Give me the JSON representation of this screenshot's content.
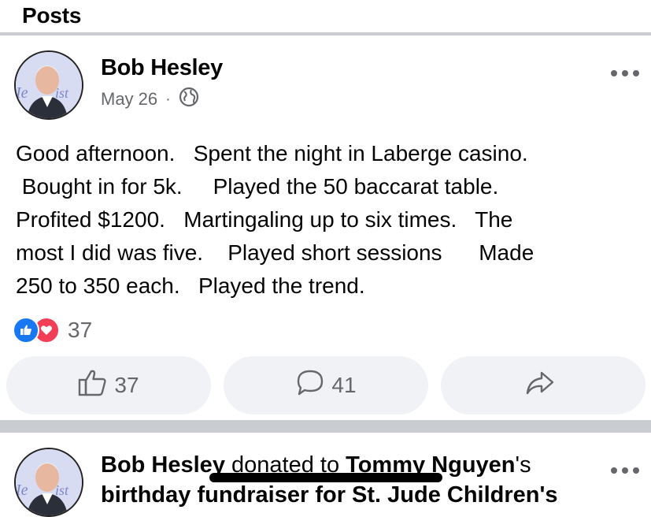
{
  "section": {
    "title": "Posts"
  },
  "post1": {
    "author": "Bob Hesley",
    "date": "May 26",
    "separator": "·",
    "visibility_icon": "globe-icon",
    "text": "Good afternoon.   Spent the night in Laberge casino.\n Bought in for 5k.     Played the 50 baccarat table.\nProfited $1200.   Martingaling up to six times.   The\nmost I did was five.    Played short sessions      Made\n250 to 350 each.   Played the trend.",
    "reactions": {
      "icons": [
        "like-icon",
        "love-icon"
      ],
      "count": "37"
    },
    "actions": {
      "like_count": "37",
      "comment_count": "41",
      "share_icon": "share-icon"
    }
  },
  "post2": {
    "author": "Bob Hesley",
    "verb": " donated to ",
    "target": "Tommy Nguyen",
    "possessive": "'s",
    "second_line": "birthday fundraiser for St. Jude Children's"
  },
  "colors": {
    "like_blue": "#1877f2",
    "love_red": "#f33e58",
    "secondary_text": "#65676b",
    "button_bg": "#f0f2f5",
    "divider": "#c9ccd1"
  }
}
